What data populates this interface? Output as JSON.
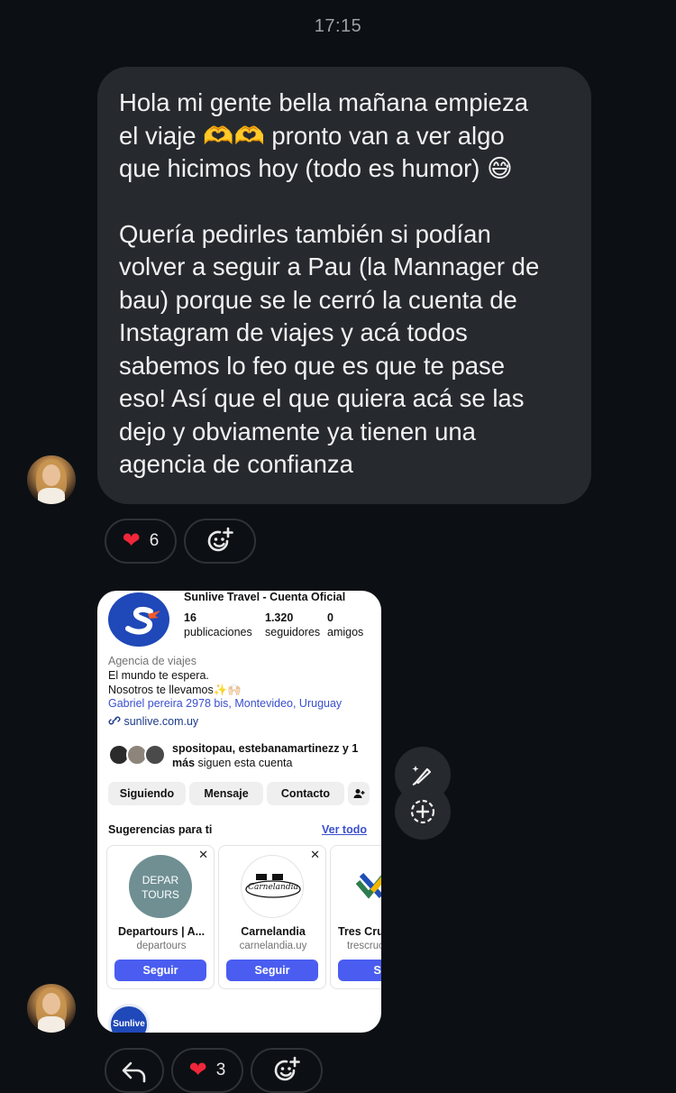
{
  "timestamp": "17:15",
  "message": {
    "paragraph1": "Hola mi gente bella mañana empieza\nel viaje 🫶🫶 pronto van a ver algo\nque hicimos hoy (todo es humor) 😅",
    "paragraph2": "Quería pedirles también si podían\nvolver a seguir a Pau (la Mannager de\nbau) porque se le cerró la cuenta de\nInstagram de viajes y acá todos\nsabemos lo feo que es que te pase\neso! Así que el que quiera acá se las\ndejo y obviamente ya tienen una\nagencia de confianza",
    "reaction_count": "6"
  },
  "shared_profile": {
    "name": "Sunlive Travel - Cuenta Oficial",
    "stats": [
      {
        "value": "16",
        "label": "publicaciones"
      },
      {
        "value": "1.320",
        "label": "seguidores"
      },
      {
        "value": "0",
        "label": "amigos"
      }
    ],
    "category": "Agencia de viajes",
    "bio_line1": "El mundo te espera.",
    "bio_line2": "Nosotros te llevamos✨🙌🏻",
    "address": "Gabriel pereira 2978 bis, Montevideo, Uruguay",
    "website": "sunlive.com.uy",
    "followed_by_line1": "spositopau, estebanamartinezz y 1",
    "followed_by_more": "más",
    "followed_by_rest": " siguen esta cuenta",
    "buttons": [
      "Siguiendo",
      "Mensaje",
      "Contacto"
    ],
    "suggestions_title": "Sugerencias para ti",
    "see_all": "Ver todo",
    "suggestions": [
      {
        "name": "Departours | A...",
        "handle": "departours",
        "logo_text1": "DEPAR",
        "logo_text2": "TOURS",
        "button": "Seguir"
      },
      {
        "name": "Carnelandia",
        "handle": "carnelandia.uy",
        "logo_text": "Carnelandia",
        "button": "Seguir"
      },
      {
        "name": "Tres Cru",
        "handle": "trescruc",
        "button": "Seg"
      }
    ],
    "bottom_avatar_text": "Sunlive"
  },
  "second_reaction_count": "3",
  "colors": {
    "background": "#0c1014",
    "bubble": "#262a2f",
    "heart": "#f0263a",
    "follow_button": "#4a5df0"
  },
  "icons": [
    "heart-icon",
    "add-reaction-icon",
    "reply-icon",
    "edit-brush-icon",
    "add-icon"
  ]
}
